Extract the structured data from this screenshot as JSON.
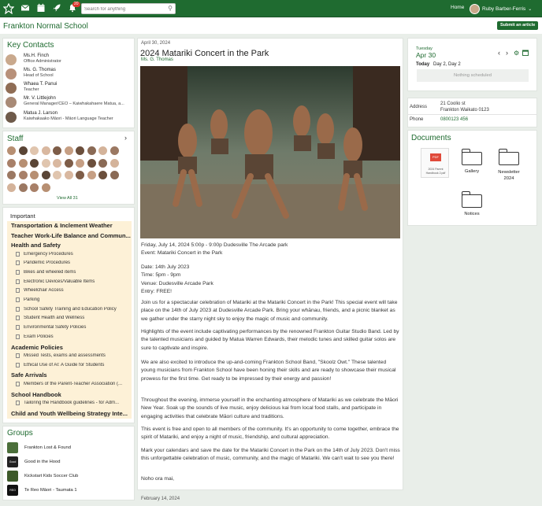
{
  "topbar": {
    "search_placeholder": "Search for anything",
    "notification_count": "20",
    "home": "Home",
    "user_name": "Ruby Barber-Ferris"
  },
  "school": {
    "name": "Frankton Normal School",
    "submit": "Submit an article"
  },
  "key_contacts": {
    "title": "Key Contacts",
    "items": [
      {
        "name": "Ms.H. Finch",
        "role": "Office Administrator"
      },
      {
        "name": "Ms. G. Thomas",
        "role": "Head of School"
      },
      {
        "name": "Whaea T. Panui",
        "role": "Teacher"
      },
      {
        "name": "Mr. V. Littlejohn",
        "role": "General Manager/CEO – Kaiwhakahaere Matua, a..."
      },
      {
        "name": "Matua J. Larson",
        "role": "Kaiwhakaako Māori - Māori Language Teacher"
      }
    ]
  },
  "staff": {
    "title": "Staff",
    "view_all": "View All 31"
  },
  "important": {
    "title": "Important",
    "cats": [
      {
        "label": "Transportation & Inclement Weather",
        "subs": []
      },
      {
        "label": "Teacher Work-Life Balance and Commun...",
        "subs": []
      },
      {
        "label": "Health and Safety",
        "subs": [
          "Emergency Procedures",
          "Pandemic Procedures",
          "Bikes and wheeled items",
          "Electronic Devices/Valuable Items",
          "Wheelchair Access",
          "Parking",
          "School Safety Training and Education Policy",
          "Student Health and Wellness",
          "Environmental Safety Policies",
          "Exam Policies"
        ]
      },
      {
        "label": "Academic Policies",
        "subs": [
          "Missed Tests, exams and assessments",
          "Ethical Use of AI: A Guide for Students"
        ]
      },
      {
        "label": "Safe Arrivals",
        "subs": [
          "Members of the Parent-Teacher Association (..."
        ]
      },
      {
        "label": "School Handbook",
        "subs": [
          "Tailoring the Handbook guidelines - for Adm..."
        ]
      },
      {
        "label": "Child and Youth Wellbeing Strategy Inte...",
        "subs": []
      }
    ]
  },
  "groups": {
    "title": "Groups",
    "items": [
      {
        "name": "Frankton Lost & Found",
        "badge": ""
      },
      {
        "name": "Good in the Hood",
        "badge": "Good"
      },
      {
        "name": "Kickstart Kids Soccer Club",
        "badge": ""
      },
      {
        "name": "Te Reo Māori - Taumata 1",
        "badge": "REO"
      }
    ]
  },
  "article": {
    "date": "April 30, 2024",
    "title": "2024 Matariki Concert in the Park",
    "author": "Ms. G. Thomas",
    "meta": "Friday, July 14, 2024 5:00p - 9:00p Dudesville The Arcade park",
    "event": "Event: Matariki Concert in the Park",
    "details": [
      "Date: 14th July 2023",
      "Time: 5pm - 9pm",
      "Venue: Dudesville Arcade Park",
      "Entry: FREE!"
    ],
    "paragraphs": [
      "Join us for a spectacular celebration of Matariki at the Matariki Concert in the Park! This special event will take place on the 14th of July 2023 at Dudesville Arcade Park. Bring your whānau, friends, and a picnic blanket as we gather under the starry night sky to enjoy the magic of music and community.",
      "Highlights of the event include captivating performances by the renowned Frankton Guitar Studio Band. Led by the talented musicians and guided by Matua Warren Edwards, their melodic tunes and skilled guitar solos are sure to captivate and inspire.",
      "We are also excited to introduce the up-and-coming Frankton School Band, \"Skoolz Owt.\" These talented young musicians from Frankton School have been honing their skills and are ready to showcase their musical prowess for the first time. Get ready to be impressed by their energy and passion!",
      "Throughout the evening, immerse yourself in the enchanting atmosphere of Matariki as we celebrate the Māori New Year. Soak up the sounds of live music, enjoy delicious kai from local food stalls, and participate in engaging activities that celebrate Māori culture and traditions.",
      "This event is free and open to all members of the community. It's an opportunity to come together, embrace the spirit of Matariki, and enjoy a night of music, friendship, and cultural appreciation.",
      "Mark your calendars and save the date for the Matariki Concert in the Park on the 14th of July 2023. Don't miss this unforgettable celebration of music, community, and the magic of Matariki. We can't wait to see you there!",
      "Noho ora mai,"
    ],
    "next_date": "February 14, 2024"
  },
  "calendar": {
    "weekday": "Tuesday",
    "date": "Apr 30",
    "today": "Today",
    "day": "Day 2, Day 2",
    "empty": "Nothing scheduled"
  },
  "info": {
    "address_label": "Address",
    "address_line1": "21 Coolio st",
    "address_line2": "Frankton Waikato 0123",
    "phone_label": "Phone",
    "phone": "0800123 456"
  },
  "documents": {
    "title": "Documents",
    "items": [
      "2024 Parent Handbook 2.pdf",
      "Gallery",
      "Newsletter 2024",
      "Notices"
    ],
    "pdf_badge": "PDF"
  },
  "colors": {
    "brand": "#1f6b30",
    "highlight": "#fdf1d7"
  }
}
